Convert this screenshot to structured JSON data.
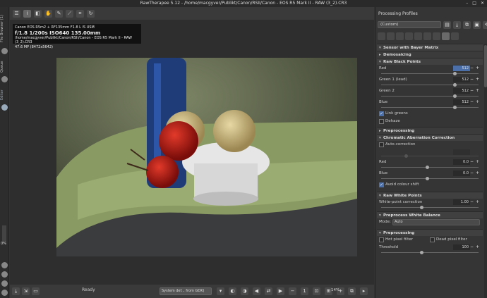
{
  "window": {
    "title": "RawTherapee 5.12 - /home/macgyver/Publikt/Canon/RSII/Canon - EOS R5 Mark II - RAW (3_2).CR3"
  },
  "left_tabs": {
    "file_browser": "File Browser (1)",
    "queue": "Queue",
    "editor": "Editor",
    "progress": "0%"
  },
  "info": {
    "line1": "Canon EOS R5m2 + RF135mm F1.8 L IS USM",
    "line2": "f/1.8  1/200s  ISO640  135.00mm",
    "line3": "/home/macgyver/Publikt/Canon/RSII/Canon - EOS R5 Mark II - RAW (3_2).CR3",
    "line4": "47.6 MP (8472x5642)"
  },
  "status": {
    "ready": "Ready",
    "output_profile": "System def... from GDK)",
    "zoom": "14%"
  },
  "panel": {
    "title": "Processing Profiles",
    "profile": "(Custom)",
    "sections": {
      "sensor": "Sensor with Bayer Matrix",
      "demosaicing": "Demosaicing",
      "raw_black": "Raw Black Points",
      "preprocessing": "Preprocessing",
      "ca": "Chromatic Aberration Correction",
      "raw_white": "Raw White Points",
      "preprocess_wb": "Preprocess White Balance",
      "preprocessing2": "Preprocessing"
    },
    "black": {
      "red_label": "Red",
      "red_val": "512",
      "green1_label": "Green 1 (lead)",
      "green1_val": "512",
      "green2_label": "Green 2",
      "green2_val": "512",
      "blue_label": "Blue",
      "blue_val": "512",
      "link_greens": "Link greens",
      "dehaze": "Dehaze"
    },
    "ca": {
      "auto": "Auto-correction",
      "red_label": "Red",
      "red_val": "0.0",
      "blue_label": "Blue",
      "blue_val": "0.0",
      "avoid_shift": "Avoid colour shift"
    },
    "white": {
      "label": "White-point correction",
      "val": "1.00"
    },
    "wb": {
      "mode_label": "Mode:",
      "mode_val": "Auto"
    },
    "pre": {
      "hot": "Hot pixel filter",
      "dead": "Dead pixel filter",
      "threshold_label": "Threshold",
      "threshold_val": "100"
    }
  }
}
